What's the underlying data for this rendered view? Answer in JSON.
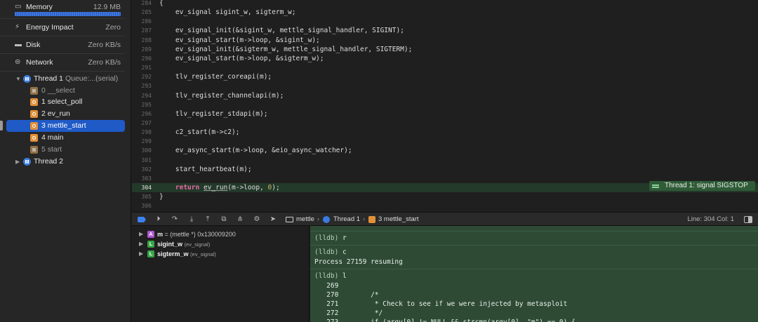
{
  "navigator": {
    "gauges": [
      {
        "label": "Memory",
        "value": "12.9 MB",
        "icon": "memory-chip-icon"
      },
      {
        "label": "Energy Impact",
        "value": "Zero",
        "icon": "energy-icon"
      },
      {
        "label": "Disk",
        "value": "Zero KB/s",
        "icon": "disk-icon"
      },
      {
        "label": "Network",
        "value": "Zero KB/s",
        "icon": "network-icon"
      }
    ],
    "thread1": {
      "label": "Thread 1",
      "queue": "Queue:...(serial)"
    },
    "frames": [
      {
        "label": "0 __select",
        "kind": "system"
      },
      {
        "label": "1 select_poll",
        "kind": "user"
      },
      {
        "label": "2 ev_run",
        "kind": "user"
      },
      {
        "label": "3 mettle_start",
        "kind": "user",
        "selected": true
      },
      {
        "label": "4 main",
        "kind": "user"
      },
      {
        "label": "5 start",
        "kind": "system"
      }
    ],
    "thread2": {
      "label": "Thread 2"
    }
  },
  "editor": {
    "lines": [
      {
        "n": "284",
        "code": "{"
      },
      {
        "n": "285",
        "code": "    ev_signal sigint_w, sigterm_w;"
      },
      {
        "n": "286",
        "code": ""
      },
      {
        "n": "287",
        "code": "    ev_signal_init(&sigint_w, mettle_signal_handler, SIGINT);"
      },
      {
        "n": "288",
        "code": "    ev_signal_start(m->loop, &sigint_w);"
      },
      {
        "n": "289",
        "code": "    ev_signal_init(&sigterm_w, mettle_signal_handler, SIGTERM);"
      },
      {
        "n": "290",
        "code": "    ev_signal_start(m->loop, &sigterm_w);"
      },
      {
        "n": "291",
        "code": ""
      },
      {
        "n": "292",
        "code": "    tlv_register_coreapi(m);"
      },
      {
        "n": "293",
        "code": ""
      },
      {
        "n": "294",
        "code": "    tlv_register_channelapi(m);"
      },
      {
        "n": "295",
        "code": ""
      },
      {
        "n": "296",
        "code": "    tlv_register_stdapi(m);"
      },
      {
        "n": "297",
        "code": ""
      },
      {
        "n": "298",
        "code": "    c2_start(m->c2);"
      },
      {
        "n": "299",
        "code": ""
      },
      {
        "n": "300",
        "code": "    ev_async_start(m->loop, &eio_async_watcher);"
      },
      {
        "n": "301",
        "code": ""
      },
      {
        "n": "302",
        "code": "    start_heartbeat(m);"
      },
      {
        "n": "303",
        "code": ""
      },
      {
        "n": "304",
        "code": "",
        "current": true
      },
      {
        "n": "305",
        "code": "}"
      },
      {
        "n": "306",
        "code": ""
      }
    ],
    "current_line": {
      "indent": "    ",
      "keyword": "return",
      "call": "ev_run",
      "args_open": "(m->loop, ",
      "number": "0",
      "args_close": ");"
    },
    "stop_annotation": "Thread 1: signal SIGSTOP"
  },
  "debug_bar": {
    "breadcrumb": [
      "mettle",
      "Thread 1",
      "3 mettle_start"
    ],
    "line_col": "Line: 304  Col: 1"
  },
  "variables": [
    {
      "badge": "A",
      "kind": "arg",
      "name": "m",
      "detail": " = (mettle *) 0x130009200",
      "type": ""
    },
    {
      "badge": "L",
      "kind": "local",
      "name": "sigint_w",
      "detail": "",
      "type": "(ev_signal)"
    },
    {
      "badge": "L",
      "kind": "local",
      "name": "sigterm_w",
      "detail": "",
      "type": "(ev_signal)"
    }
  ],
  "console": {
    "lines": [
      {
        "prompt": "(lldb)",
        "text": " r"
      },
      {
        "prompt": "(lldb)",
        "text": " c"
      },
      {
        "prompt": "",
        "text": "Process 27159 resuming"
      },
      {
        "prompt": "(lldb)",
        "text": " l"
      },
      {
        "prompt": "",
        "text": "   269"
      },
      {
        "prompt": "",
        "text": "   270        /*"
      },
      {
        "prompt": "",
        "text": "   271         * Check to see if we were injected by metasploit"
      },
      {
        "prompt": "",
        "text": "   272         */"
      },
      {
        "prompt": "",
        "text": "   273        if (argv[0] != NULL && strcmp(argv[0], \"m\") == 0) {"
      }
    ]
  }
}
